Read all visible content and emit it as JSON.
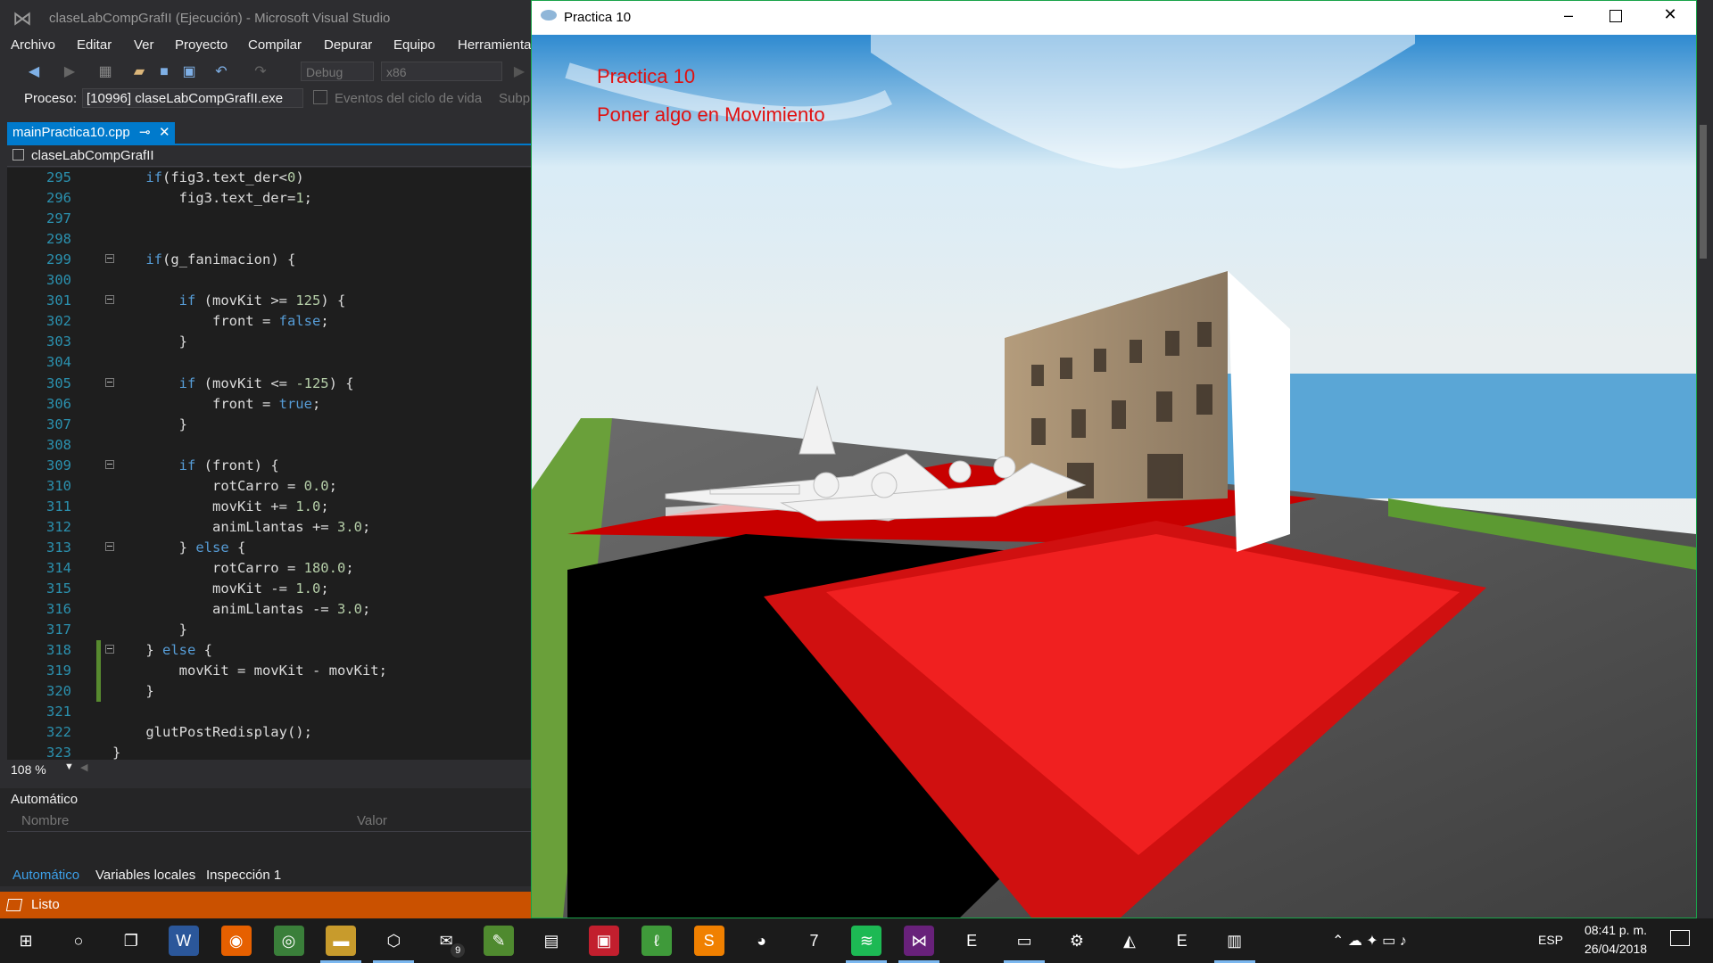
{
  "vs": {
    "title": "claseLabCompGrafII (Ejecución) - Microsoft Visual Studio",
    "menu": [
      "Archivo",
      "Editar",
      "Ver",
      "Proyecto",
      "Compilar",
      "Depurar",
      "Equipo",
      "Herramienta"
    ],
    "toolbar": {
      "config": "Debug",
      "platform": "x86"
    },
    "process_label": "Proceso:",
    "process_value": "[10996] claseLabCompGrafII.exe",
    "lifecycle_label": "Eventos del ciclo de vida",
    "subp_label": "Subp",
    "tab": "mainPractica10.cpp",
    "nav_scope": "claseLabCompGrafII",
    "zoom": "108 %",
    "auto_title": "Automático",
    "col_name": "Nombre",
    "col_value": "Valor",
    "bottom_tabs": [
      "Automático",
      "Variables locales",
      "Inspección 1"
    ],
    "status": "Listo"
  },
  "code": [
    {
      "n": "295",
      "t": "    if(fig3.text_der<0)"
    },
    {
      "n": "296",
      "t": "        fig3.text_der=1;"
    },
    {
      "n": "297",
      "t": ""
    },
    {
      "n": "298",
      "t": ""
    },
    {
      "n": "299",
      "t": "    if(g_fanimacion) {"
    },
    {
      "n": "300",
      "t": ""
    },
    {
      "n": "301",
      "t": "        if (movKit >= 125) {"
    },
    {
      "n": "302",
      "t": "            front = false;"
    },
    {
      "n": "303",
      "t": "        }"
    },
    {
      "n": "304",
      "t": ""
    },
    {
      "n": "305",
      "t": "        if (movKit <= -125) {"
    },
    {
      "n": "306",
      "t": "            front = true;"
    },
    {
      "n": "307",
      "t": "        }"
    },
    {
      "n": "308",
      "t": ""
    },
    {
      "n": "309",
      "t": "        if (front) {"
    },
    {
      "n": "310",
      "t": "            rotCarro = 0.0;"
    },
    {
      "n": "311",
      "t": "            movKit += 1.0;"
    },
    {
      "n": "312",
      "t": "            animLlantas += 3.0;"
    },
    {
      "n": "313",
      "t": "        } else {"
    },
    {
      "n": "314",
      "t": "            rotCarro = 180.0;"
    },
    {
      "n": "315",
      "t": "            movKit -= 1.0;"
    },
    {
      "n": "316",
      "t": "            animLlantas -= 3.0;"
    },
    {
      "n": "317",
      "t": "        }"
    },
    {
      "n": "318",
      "t": "    } else {"
    },
    {
      "n": "319",
      "t": "        movKit = movKit - movKit;"
    },
    {
      "n": "320",
      "t": "    }"
    },
    {
      "n": "321",
      "t": ""
    },
    {
      "n": "322",
      "t": "    glutPostRedisplay();"
    },
    {
      "n": "323",
      "t": "}"
    }
  ],
  "practica": {
    "title": "Practica 10",
    "overlay1": "Practica 10",
    "overlay2": "Poner algo en Movimiento"
  },
  "taskbar": {
    "lang": "ESP",
    "time": "08:41 p. m.",
    "date": "26/04/2018",
    "mail_badge": "9",
    "icons": [
      "start-icon",
      "cortana-icon",
      "task-view-icon",
      "word-icon",
      "firefox-icon",
      "chrome-icon",
      "file-explorer-icon",
      "virtualbox-icon",
      "mail-icon",
      "paint-icon",
      "notepadpp-icon",
      "photoshop-icon",
      "android-icon",
      "sublime-icon",
      "github-icon",
      "seven-zip-icon",
      "spotify-icon",
      "visual-studio-icon",
      "epic-games-icon",
      "terminal-icon",
      "settings-icon",
      "geforce-icon",
      "epic-games-2-icon",
      "app-window-icon"
    ]
  },
  "colors": {
    "accent": "#007acc",
    "status": "#ca5100",
    "overlay_text": "#e01010"
  }
}
